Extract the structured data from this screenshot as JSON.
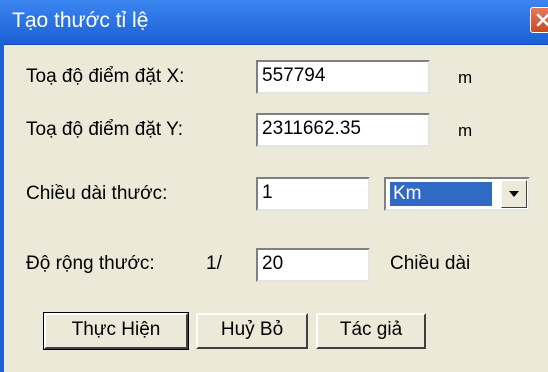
{
  "window": {
    "title": "Tạo thước tỉ lệ"
  },
  "fields": {
    "x_label": "Toạ độ điểm đặt X:",
    "x_value": "557794",
    "x_unit": "m",
    "y_label": "Toạ độ điểm đặt Y:",
    "y_value": "2311662.35",
    "y_unit": "m",
    "length_label": "Chiều dài thước:",
    "length_value": "1",
    "length_unit_selected": "Km",
    "width_label": "Độ rộng thước:",
    "width_ratio_prefix": "1/",
    "width_value": "20",
    "width_suffix": "Chiều dài"
  },
  "buttons": {
    "execute": "Thực Hiện",
    "cancel": "Huỷ Bỏ",
    "author": "Tác giả"
  },
  "icons": {
    "close": "close-icon",
    "dropdown": "chevron-down-icon"
  },
  "colors": {
    "titlebar": "#1c5fd7",
    "close": "#c84a22",
    "selection": "#316ac5",
    "dialog_bg": "#ece9d8"
  }
}
